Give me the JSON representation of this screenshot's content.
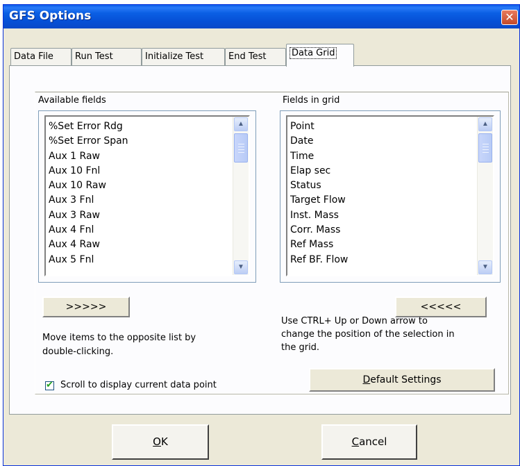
{
  "window": {
    "title": "GFS Options",
    "close_glyph": "✕"
  },
  "tabs": [
    {
      "label": "Data File"
    },
    {
      "label": "Run Test"
    },
    {
      "label": "Initialize Test"
    },
    {
      "label": "End Test"
    },
    {
      "label": "Data Grid",
      "active": true
    }
  ],
  "available": {
    "label": "Available fields",
    "items": [
      "%Set Error Rdg",
      "%Set Error Span",
      "Aux 1 Raw",
      "Aux 10 Fnl",
      "Aux 10 Raw",
      "Aux 3 Fnl",
      "Aux 3 Raw",
      "Aux 4 Fnl",
      "Aux 4 Raw",
      "Aux 5 Fnl"
    ]
  },
  "grid": {
    "label": "Fields in grid",
    "items": [
      "Point",
      "Date",
      "Time",
      "Elap sec",
      "Status",
      "Target Flow",
      "Inst. Mass",
      "Corr. Mass",
      "Ref Mass",
      "Ref BF. Flow"
    ]
  },
  "move_right_label": ">>>>>",
  "move_left_label": "<<<<<",
  "help_left": [
    "Move items to the opposite list by",
    "double-clicking."
  ],
  "help_right": [
    "Use CTRL+ Up or Down arrow to",
    "change the position of the selection in",
    "the grid."
  ],
  "scroll_checkbox": {
    "label": "Scroll to display current data point",
    "checked": true
  },
  "default_settings": {
    "accel": "D",
    "rest": "efault Settings"
  },
  "ok": {
    "accel": "O",
    "rest": "K"
  },
  "cancel": {
    "accel": "C",
    "rest": "ancel"
  },
  "scroll_up_glyph": "▲",
  "scroll_down_glyph": "▼",
  "checkmark_glyph": "✔"
}
